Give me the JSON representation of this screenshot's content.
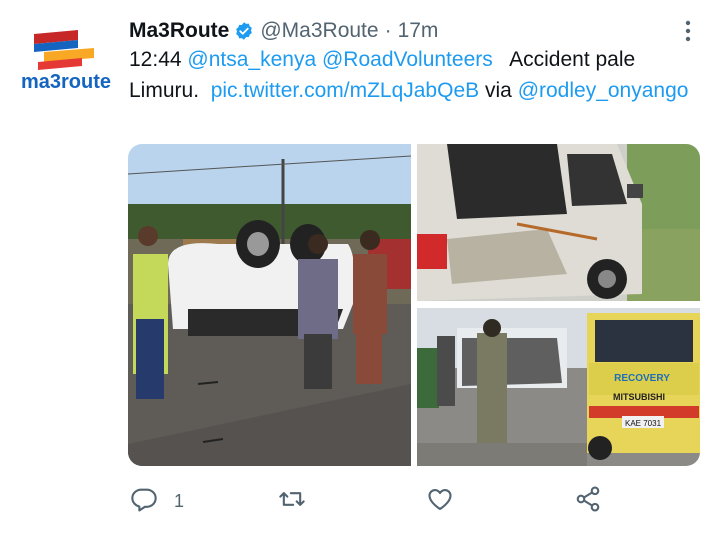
{
  "tweet": {
    "display_name": "Ma3Route",
    "handle": "@Ma3Route",
    "separator": "·",
    "time": "17m",
    "verified": true,
    "avatar_logo_text": "ma3route",
    "text": {
      "time": "12:44",
      "mention_1": "@ntsa_kenya",
      "mention_2": "@RoadVolunteers",
      "body": "Accident pale Limuru.",
      "link": "pic.twitter.com/mZLqJabQeB",
      "via": "via",
      "mention_3": "@rodley_onyango"
    },
    "media": {
      "photo_count": 3,
      "truck_lettering": [
        "RECOVERY",
        "MITSUBISHI"
      ],
      "truck_plate": "KAE 7031"
    },
    "actions": {
      "reply_icon": "reply-icon",
      "reply_count": "1",
      "retweet_icon": "retweet-icon",
      "like_icon": "heart-icon",
      "share_icon": "share-icon"
    }
  },
  "colors": {
    "link": "#1d9bf0",
    "verified": "#1d9bf0",
    "secondary_text": "#536471"
  }
}
